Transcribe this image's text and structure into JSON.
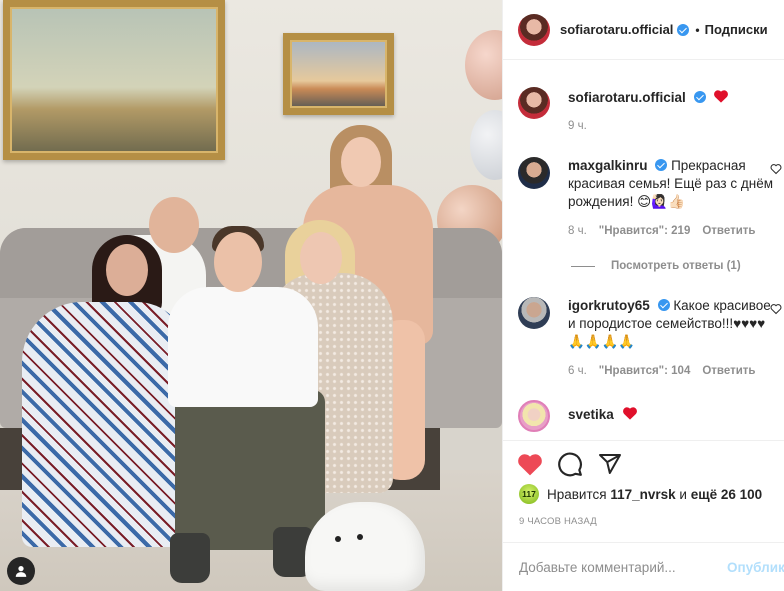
{
  "header": {
    "username": "sofiarotaru.official",
    "separator": "•",
    "follow_label": "Подписки"
  },
  "caption": {
    "username": "sofiarotaru.official",
    "time": "9 ч."
  },
  "comments": [
    {
      "username": "maxgalkinru",
      "verified": true,
      "text": "Прекрасная красивая семья! Ещё раз с днём рождения! 😊🙋🏻‍♀️👍🏻",
      "time": "8 ч.",
      "likes_label": "\"Нравится\": 219",
      "reply_label": "Ответить"
    },
    {
      "username": "igorkrutoy65",
      "verified": true,
      "text": "Какое красивое и породистое семейство!!!♥♥♥♥ 🙏🙏🙏🙏",
      "time": "6 ч.",
      "likes_label": "\"Нравится\": 104",
      "reply_label": "Ответить"
    },
    {
      "username": "svetika",
      "verified": false,
      "text": "",
      "time": "",
      "likes_label": "",
      "reply_label": ""
    }
  ],
  "view_replies_label": "Посмотреть ответы (1)",
  "likes": {
    "badge": "117",
    "prefix": "Нравится",
    "user": "117_nvrsk",
    "joiner": "и",
    "others": "ещё 26 100"
  },
  "posted_ago": "9 ЧАСОВ НАЗАД",
  "comment_box": {
    "placeholder": "Добавьте комментарий...",
    "publish_label": "Опубликовать"
  },
  "icons": {
    "verified": "verified-badge-icon",
    "like": "heart-filled-icon",
    "comment": "comment-bubble-icon",
    "share": "paper-plane-icon",
    "tag": "person-tag-icon"
  },
  "colors": {
    "like_red": "#ed4956",
    "verified_blue": "#3897f0",
    "muted_text": "#8e8e8e",
    "publish_disabled": "#b2dffc"
  }
}
